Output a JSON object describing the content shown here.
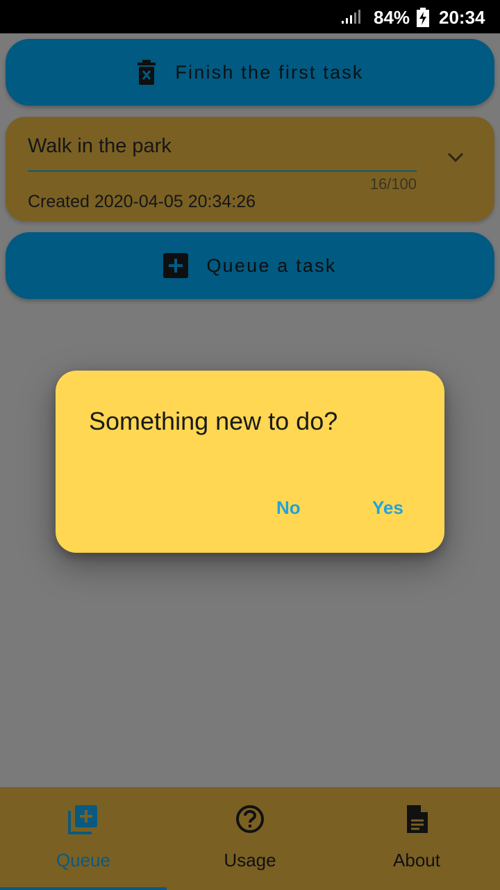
{
  "status_bar": {
    "battery_percent": "84%",
    "time": "20:34"
  },
  "actions": {
    "finish_label": "Finish the first task",
    "queue_label": "Queue a task"
  },
  "task": {
    "text": "Walk in the park",
    "counter": "16/100",
    "created": "Created 2020-04-05 20:34:26"
  },
  "dialog": {
    "title": "Something new to do?",
    "no_label": "No",
    "yes_label": "Yes"
  },
  "bottom_nav": {
    "items": [
      {
        "label": "Queue",
        "icon": "queue-add-icon",
        "selected": true
      },
      {
        "label": "Usage",
        "icon": "help-circle-icon",
        "selected": false
      },
      {
        "label": "About",
        "icon": "document-icon",
        "selected": false
      }
    ]
  },
  "colors": {
    "primary_button": "#005a82",
    "card": "#7a6023",
    "dialog": "#ffd752",
    "dialog_action": "#22a3dc",
    "nav_selected": "#0a5a80"
  }
}
